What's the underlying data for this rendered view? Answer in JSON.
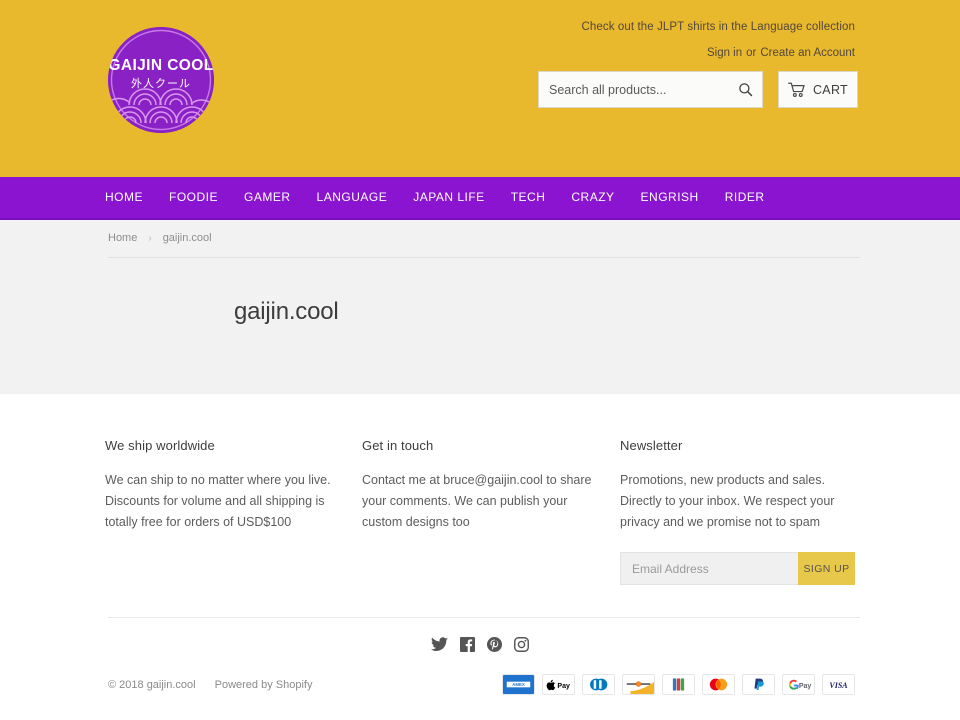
{
  "colors": {
    "header_bg": "#e8b92c",
    "nav_bg": "#8a14d0",
    "content_bg": "#f2f2f2",
    "logo_purple": "#8a21c4",
    "accent_yellow": "#e8c84a"
  },
  "header": {
    "logo": {
      "name": "gaijin.cool",
      "text_en": "GAIJIN COOL",
      "text_jp": "外人クール"
    },
    "promo_text": "Check out the JLPT shirts in the Language collection",
    "sign_in_label": "Sign in",
    "or_label": "or",
    "create_account_label": "Create an Account",
    "search": {
      "placeholder": "Search all products...",
      "value": "",
      "icon": "search-icon"
    },
    "cart": {
      "label": "CART",
      "icon": "shopping-cart-icon"
    }
  },
  "nav": {
    "items": [
      {
        "label": "HOME"
      },
      {
        "label": "FOODIE"
      },
      {
        "label": "GAMER"
      },
      {
        "label": "LANGUAGE"
      },
      {
        "label": "JAPAN LIFE"
      },
      {
        "label": "TECH"
      },
      {
        "label": "CRAZY"
      },
      {
        "label": "ENGRISH"
      },
      {
        "label": "RIDER"
      }
    ]
  },
  "breadcrumb": {
    "home_label": "Home",
    "separator": "›",
    "current_label": "gaijin.cool"
  },
  "main": {
    "page_title": "gaijin.cool"
  },
  "footer": {
    "columns": [
      {
        "title": "We ship worldwide",
        "body": "We can ship to no matter where you live. Discounts for volume and all shipping is totally free for orders of USD$100"
      },
      {
        "title": "Get in touch",
        "body": "Contact me at bruce@gaijin.cool to share your comments. We can publish your custom designs too"
      },
      {
        "title": "Newsletter",
        "body": "Promotions, new products and sales. Directly to your inbox. We respect your privacy and we promise not to spam"
      }
    ],
    "newsletter": {
      "placeholder": "Email Address",
      "value": "",
      "button_label": "SIGN UP"
    },
    "social": [
      {
        "name": "twitter-icon"
      },
      {
        "name": "facebook-icon"
      },
      {
        "name": "pinterest-icon"
      },
      {
        "name": "instagram-icon"
      }
    ],
    "copyright": "© 2018 gaijin.cool",
    "powered_by": "Powered by Shopify",
    "payment_methods": [
      {
        "name": "amex",
        "label": "AMEX"
      },
      {
        "name": "apple-pay",
        "label": "Pay"
      },
      {
        "name": "diners-club",
        "label": "Diners Club"
      },
      {
        "name": "discover",
        "label": "Discover"
      },
      {
        "name": "jcb",
        "label": "JCB"
      },
      {
        "name": "mastercard",
        "label": "Mastercard"
      },
      {
        "name": "paypal",
        "label": "PayPal"
      },
      {
        "name": "google-pay",
        "label": "Pay"
      },
      {
        "name": "visa",
        "label": "VISA"
      }
    ]
  }
}
